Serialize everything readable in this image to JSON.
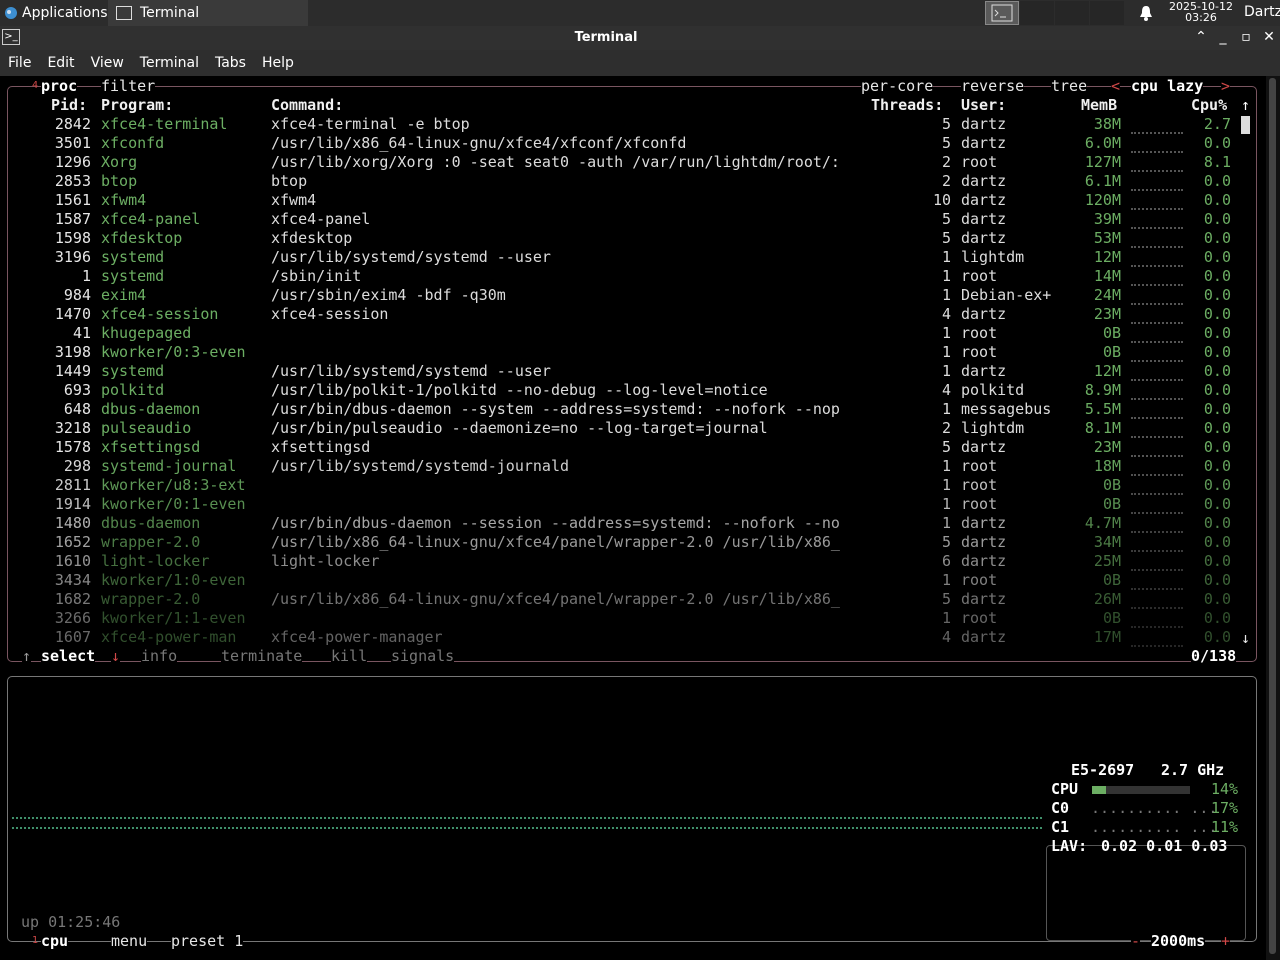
{
  "taskbar": {
    "applications_label": "Applications",
    "window_button_label": "Terminal",
    "clock_date": "2025-10-12",
    "clock_time": "03:26",
    "user": "Dartz"
  },
  "window": {
    "title": "Terminal",
    "menu": [
      "File",
      "Edit",
      "View",
      "Terminal",
      "Tabs",
      "Help"
    ]
  },
  "proc": {
    "tab_num": "4",
    "tab_label": "proc",
    "filter_label": "filter",
    "per_core": "per-core",
    "reverse": "reverse",
    "tree": "tree",
    "sort_prev": "<",
    "sort_field": "cpu lazy",
    "sort_next": ">",
    "columns": {
      "pid": "Pid:",
      "program": "Program:",
      "command": "Command:",
      "threads": "Threads:",
      "user": "User:",
      "mem": "MemB",
      "cpu": "Cpu%"
    },
    "rows": [
      {
        "pid": "2842",
        "program": "xfce4-terminal",
        "command": "xfce4-terminal -e btop",
        "threads": "5",
        "user": "dartz",
        "mem": "38M",
        "cpu": "2.7"
      },
      {
        "pid": "3501",
        "program": "xfconfd",
        "command": "/usr/lib/x86_64-linux-gnu/xfce4/xfconf/xfconfd",
        "threads": "5",
        "user": "dartz",
        "mem": "6.0M",
        "cpu": "0.0"
      },
      {
        "pid": "1296",
        "program": "Xorg",
        "command": "/usr/lib/xorg/Xorg :0 -seat seat0 -auth /var/run/lightdm/root/:",
        "threads": "2",
        "user": "root",
        "mem": "127M",
        "cpu": "8.1"
      },
      {
        "pid": "2853",
        "program": "btop",
        "command": "btop",
        "threads": "2",
        "user": "dartz",
        "mem": "6.1M",
        "cpu": "0.0"
      },
      {
        "pid": "1561",
        "program": "xfwm4",
        "command": "xfwm4",
        "threads": "10",
        "user": "dartz",
        "mem": "120M",
        "cpu": "0.0"
      },
      {
        "pid": "1587",
        "program": "xfce4-panel",
        "command": "xfce4-panel",
        "threads": "5",
        "user": "dartz",
        "mem": "39M",
        "cpu": "0.0"
      },
      {
        "pid": "1598",
        "program": "xfdesktop",
        "command": "xfdesktop",
        "threads": "5",
        "user": "dartz",
        "mem": "53M",
        "cpu": "0.0"
      },
      {
        "pid": "3196",
        "program": "systemd",
        "command": "/usr/lib/systemd/systemd --user",
        "threads": "1",
        "user": "lightdm",
        "mem": "12M",
        "cpu": "0.0"
      },
      {
        "pid": "1",
        "program": "systemd",
        "command": "/sbin/init",
        "threads": "1",
        "user": "root",
        "mem": "14M",
        "cpu": "0.0"
      },
      {
        "pid": "984",
        "program": "exim4",
        "command": "/usr/sbin/exim4 -bdf -q30m",
        "threads": "1",
        "user": "Debian-ex+",
        "mem": "24M",
        "cpu": "0.0"
      },
      {
        "pid": "1470",
        "program": "xfce4-session",
        "command": "xfce4-session",
        "threads": "4",
        "user": "dartz",
        "mem": "23M",
        "cpu": "0.0"
      },
      {
        "pid": "41",
        "program": "khugepaged",
        "command": "",
        "threads": "1",
        "user": "root",
        "mem": "0B",
        "cpu": "0.0"
      },
      {
        "pid": "3198",
        "program": "kworker/0:3-even",
        "command": "",
        "threads": "1",
        "user": "root",
        "mem": "0B",
        "cpu": "0.0"
      },
      {
        "pid": "1449",
        "program": "systemd",
        "command": "/usr/lib/systemd/systemd --user",
        "threads": "1",
        "user": "dartz",
        "mem": "12M",
        "cpu": "0.0"
      },
      {
        "pid": "693",
        "program": "polkitd",
        "command": "/usr/lib/polkit-1/polkitd --no-debug --log-level=notice",
        "threads": "4",
        "user": "polkitd",
        "mem": "8.9M",
        "cpu": "0.0"
      },
      {
        "pid": "648",
        "program": "dbus-daemon",
        "command": "/usr/bin/dbus-daemon --system --address=systemd: --nofork --nop",
        "threads": "1",
        "user": "messagebus",
        "mem": "5.5M",
        "cpu": "0.0"
      },
      {
        "pid": "3218",
        "program": "pulseaudio",
        "command": "/usr/bin/pulseaudio --daemonize=no --log-target=journal",
        "threads": "2",
        "user": "lightdm",
        "mem": "8.1M",
        "cpu": "0.0"
      },
      {
        "pid": "1578",
        "program": "xfsettingsd",
        "command": "xfsettingsd",
        "threads": "5",
        "user": "dartz",
        "mem": "23M",
        "cpu": "0.0"
      },
      {
        "pid": "298",
        "program": "systemd-journal",
        "command": "/usr/lib/systemd/systemd-journald",
        "threads": "1",
        "user": "root",
        "mem": "18M",
        "cpu": "0.0"
      },
      {
        "pid": "2811",
        "program": "kworker/u8:3-ext",
        "command": "",
        "threads": "1",
        "user": "root",
        "mem": "0B",
        "cpu": "0.0"
      },
      {
        "pid": "1914",
        "program": "kworker/0:1-even",
        "command": "",
        "threads": "1",
        "user": "root",
        "mem": "0B",
        "cpu": "0.0"
      },
      {
        "pid": "1480",
        "program": "dbus-daemon",
        "command": "/usr/bin/dbus-daemon --session --address=systemd: --nofork --no",
        "threads": "1",
        "user": "dartz",
        "mem": "4.7M",
        "cpu": "0.0"
      },
      {
        "pid": "1652",
        "program": "wrapper-2.0",
        "command": "/usr/lib/x86_64-linux-gnu/xfce4/panel/wrapper-2.0 /usr/lib/x86_",
        "threads": "5",
        "user": "dartz",
        "mem": "34M",
        "cpu": "0.0"
      },
      {
        "pid": "1610",
        "program": "light-locker",
        "command": "light-locker",
        "threads": "6",
        "user": "dartz",
        "mem": "25M",
        "cpu": "0.0"
      },
      {
        "pid": "3434",
        "program": "kworker/1:0-even",
        "command": "",
        "threads": "1",
        "user": "root",
        "mem": "0B",
        "cpu": "0.0"
      },
      {
        "pid": "1682",
        "program": "wrapper-2.0",
        "command": "/usr/lib/x86_64-linux-gnu/xfce4/panel/wrapper-2.0 /usr/lib/x86_",
        "threads": "5",
        "user": "dartz",
        "mem": "26M",
        "cpu": "0.0"
      },
      {
        "pid": "3266",
        "program": "kworker/1:1-even",
        "command": "",
        "threads": "1",
        "user": "root",
        "mem": "0B",
        "cpu": "0.0"
      },
      {
        "pid": "1607",
        "program": "xfce4-power-man",
        "command": "xfce4-power-manager",
        "threads": "4",
        "user": "dartz",
        "mem": "17M",
        "cpu": "0.0"
      }
    ],
    "footer": {
      "select": "select",
      "info": "info",
      "terminate": "terminate",
      "kill": "kill",
      "signals": "signals",
      "count": "0/138"
    }
  },
  "cpu": {
    "model": "E5-2697",
    "freq": "2.7 GHz",
    "total_label": "CPU",
    "total_pct": "14%",
    "total_fill_fraction": 0.14,
    "core0_label": "C0",
    "core0_pct": "17%",
    "core1_label": "C1",
    "core1_pct": "11%",
    "lav_label": "LAV:",
    "lav": "0.02 0.01 0.03",
    "uptime": "up 01:25:46",
    "tab_num": "1",
    "tab_label": "cpu",
    "menu": "menu",
    "preset": "preset 1",
    "interval_minus": "-",
    "interval": "2000ms",
    "interval_plus": "+"
  }
}
